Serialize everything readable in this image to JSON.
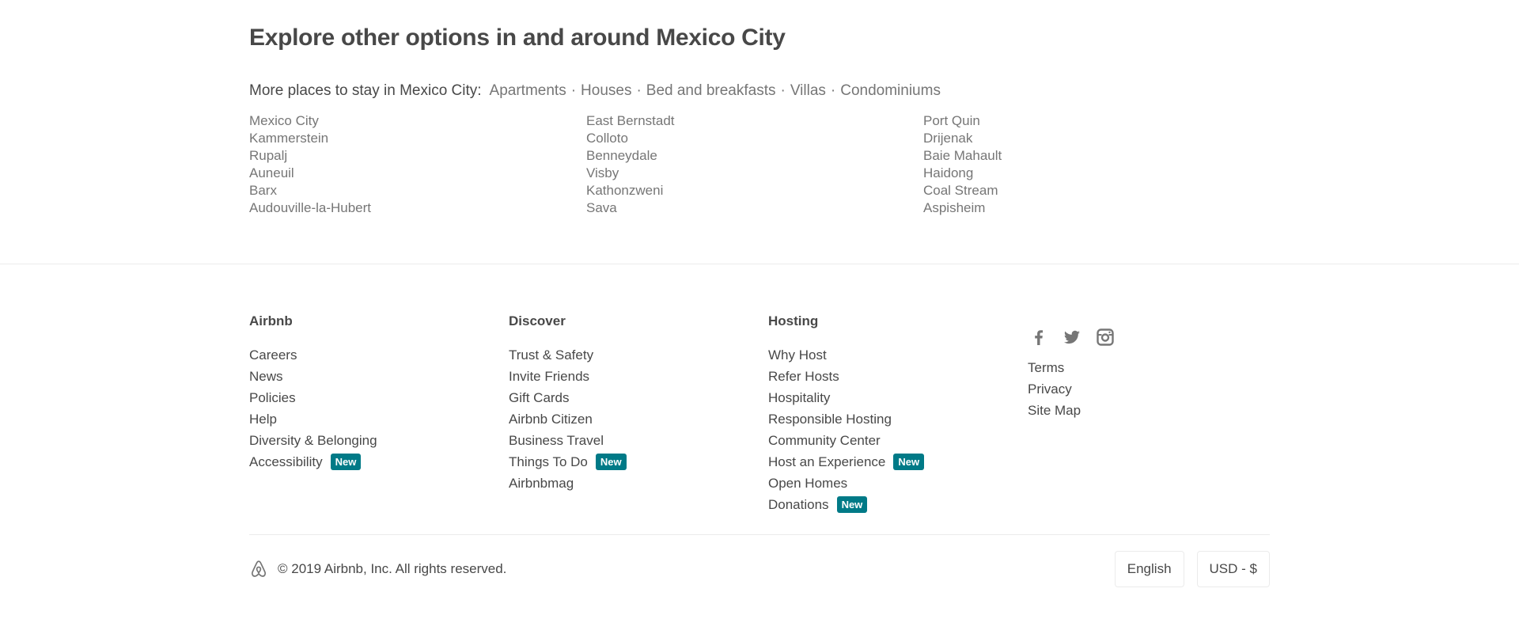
{
  "explore": {
    "title": "Explore other options in and around Mexico City",
    "more_places_label": "More places to stay in Mexico City:",
    "place_types": [
      "Apartments",
      "Houses",
      "Bed and breakfasts",
      "Villas",
      "Condominiums"
    ],
    "separator": "·",
    "cities": [
      [
        "Mexico City",
        "Kammerstein",
        "Rupalj",
        "Auneuil",
        "Barx",
        "Audouville-la-Hubert"
      ],
      [
        "East Bernstadt",
        "Colloto",
        "Benneydale",
        "Visby",
        "Kathonzweni",
        "Sava"
      ],
      [
        "Port Quin",
        "Drijenak",
        "Baie Mahault",
        "Haidong",
        "Coal Stream",
        "Aspisheim"
      ]
    ]
  },
  "footer": {
    "columns": [
      {
        "title": "Airbnb",
        "links": [
          {
            "label": "Careers",
            "badge": ""
          },
          {
            "label": "News",
            "badge": ""
          },
          {
            "label": "Policies",
            "badge": ""
          },
          {
            "label": "Help",
            "badge": ""
          },
          {
            "label": "Diversity & Belonging",
            "badge": ""
          },
          {
            "label": "Accessibility",
            "badge": "New"
          }
        ]
      },
      {
        "title": "Discover",
        "links": [
          {
            "label": "Trust & Safety",
            "badge": ""
          },
          {
            "label": "Invite Friends",
            "badge": ""
          },
          {
            "label": "Gift Cards",
            "badge": ""
          },
          {
            "label": "Airbnb Citizen",
            "badge": ""
          },
          {
            "label": "Business Travel",
            "badge": ""
          },
          {
            "label": "Things To Do",
            "badge": "New"
          },
          {
            "label": "Airbnbmag",
            "badge": ""
          }
        ]
      },
      {
        "title": "Hosting",
        "links": [
          {
            "label": "Why Host",
            "badge": ""
          },
          {
            "label": "Refer Hosts",
            "badge": ""
          },
          {
            "label": "Hospitality",
            "badge": ""
          },
          {
            "label": "Responsible Hosting",
            "badge": ""
          },
          {
            "label": "Community Center",
            "badge": ""
          },
          {
            "label": "Host an Experience",
            "badge": "New"
          },
          {
            "label": "Open Homes",
            "badge": ""
          },
          {
            "label": "Donations",
            "badge": "New"
          }
        ]
      }
    ],
    "social_icons": [
      "facebook-icon",
      "twitter-icon",
      "instagram-icon"
    ],
    "legal_links": [
      "Terms",
      "Privacy",
      "Site Map"
    ],
    "copyright": "© 2019 Airbnb, Inc. All rights reserved.",
    "language": "English",
    "currency": "USD - $"
  },
  "colors": {
    "text": "#484848",
    "muted": "#767676",
    "badge": "#007a87",
    "divider": "#ebebeb"
  }
}
